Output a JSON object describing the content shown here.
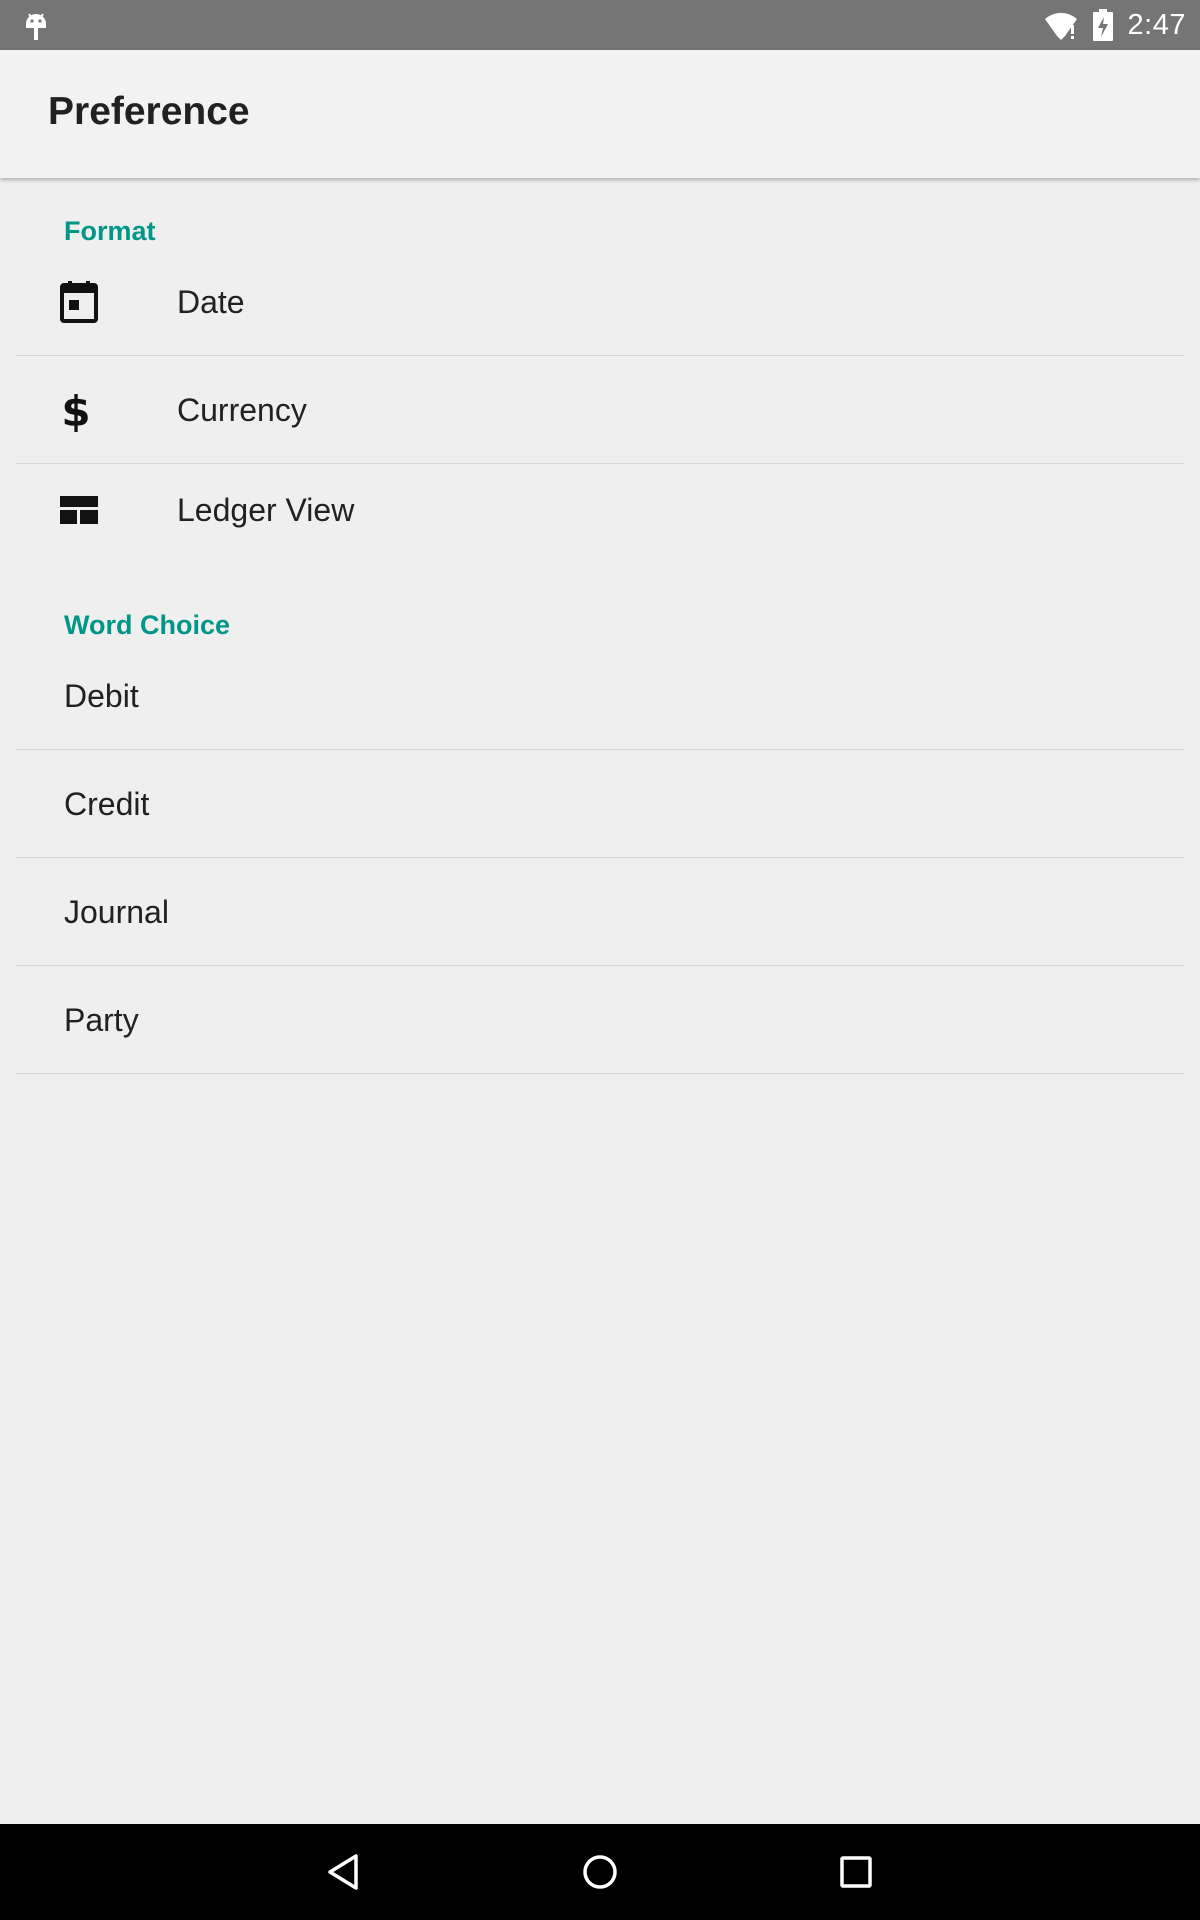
{
  "status_bar": {
    "time": "2:47",
    "icons": [
      "android-notification-icon",
      "wifi-icon",
      "battery-charging-icon"
    ]
  },
  "toolbar": {
    "title": "Preference"
  },
  "sections": {
    "format": {
      "header": "Format",
      "items": [
        {
          "label": "Date",
          "icon": "calendar-icon"
        },
        {
          "label": "Currency",
          "icon": "dollar-icon"
        },
        {
          "label": "Ledger View",
          "icon": "table-layout-icon"
        }
      ]
    },
    "word_choice": {
      "header": "Word Choice",
      "items": [
        {
          "label": "Debit"
        },
        {
          "label": "Credit"
        },
        {
          "label": "Journal"
        },
        {
          "label": "Party"
        }
      ]
    }
  },
  "nav_bar": {
    "icons": [
      "back-icon",
      "home-icon",
      "recents-icon"
    ]
  },
  "colors": {
    "accent": "#009688",
    "status_bar": "#757575",
    "background": "#efefef",
    "nav_bar": "#000000"
  }
}
